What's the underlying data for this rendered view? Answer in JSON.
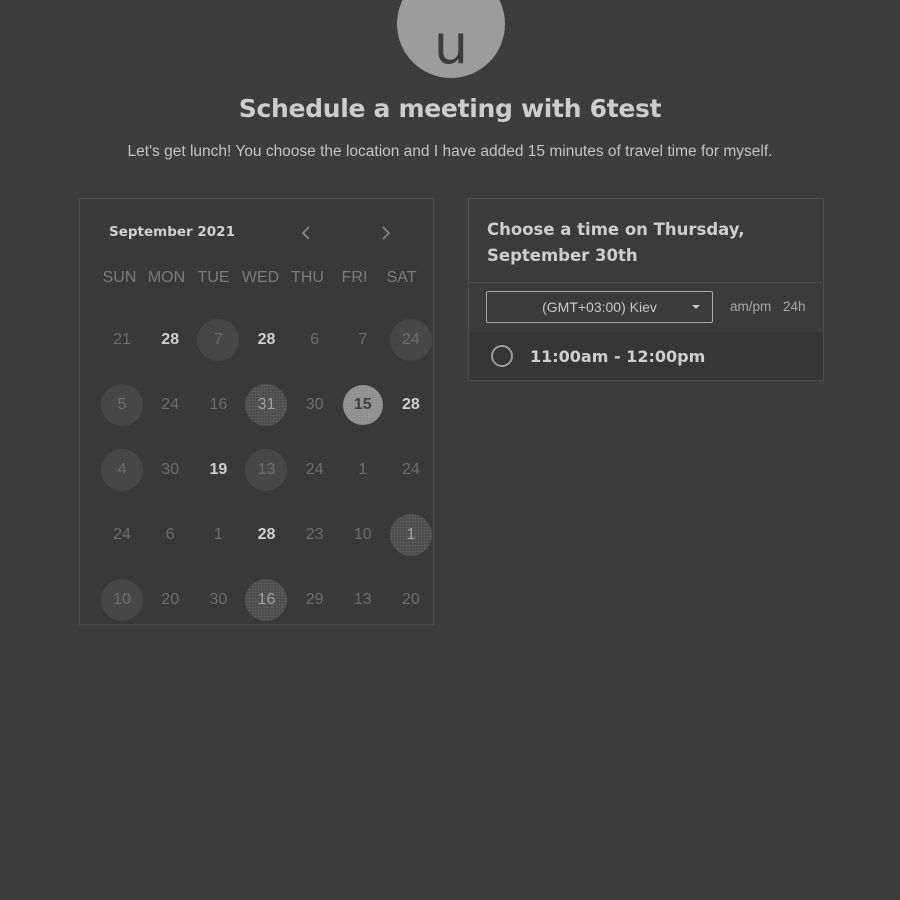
{
  "avatar": {
    "initial": "u"
  },
  "header": {
    "title": "Schedule a meeting with 6test",
    "subtitle": "Let's get lunch! You choose the location and I have added 15 minutes of travel time for myself."
  },
  "calendar": {
    "month": "September 2021",
    "weekdays": [
      "SUN",
      "MON",
      "TUE",
      "WED",
      "THU",
      "FRI",
      "SAT"
    ],
    "rows": [
      [
        {
          "d": "21",
          "s": "plain"
        },
        {
          "d": "28",
          "s": "bold"
        },
        {
          "d": "7",
          "s": "avail"
        },
        {
          "d": "28",
          "s": "bold"
        },
        {
          "d": "6",
          "s": "plain"
        },
        {
          "d": "7",
          "s": "plain"
        },
        {
          "d": "24",
          "s": "avail"
        }
      ],
      [
        {
          "d": "5",
          "s": "avail"
        },
        {
          "d": "24",
          "s": "plain"
        },
        {
          "d": "16",
          "s": "plain"
        },
        {
          "d": "31",
          "s": "dotted"
        },
        {
          "d": "30",
          "s": "plain"
        },
        {
          "d": "15",
          "s": "selected"
        },
        {
          "d": "28",
          "s": "bold"
        }
      ],
      [
        {
          "d": "4",
          "s": "avail"
        },
        {
          "d": "30",
          "s": "plain"
        },
        {
          "d": "19",
          "s": "bold"
        },
        {
          "d": "13",
          "s": "avail"
        },
        {
          "d": "24",
          "s": "plain"
        },
        {
          "d": "1",
          "s": "plain"
        },
        {
          "d": "24",
          "s": "plain"
        }
      ],
      [
        {
          "d": "24",
          "s": "plain"
        },
        {
          "d": "6",
          "s": "plain"
        },
        {
          "d": "1",
          "s": "plain"
        },
        {
          "d": "28",
          "s": "bold"
        },
        {
          "d": "23",
          "s": "plain"
        },
        {
          "d": "10",
          "s": "plain"
        },
        {
          "d": "1",
          "s": "dotted"
        }
      ],
      [
        {
          "d": "10",
          "s": "avail"
        },
        {
          "d": "20",
          "s": "plain"
        },
        {
          "d": "30",
          "s": "plain"
        },
        {
          "d": "16",
          "s": "dotted"
        },
        {
          "d": "29",
          "s": "plain"
        },
        {
          "d": "13",
          "s": "plain"
        },
        {
          "d": "20",
          "s": "plain"
        }
      ]
    ]
  },
  "time_panel": {
    "title": "Choose a time on Thursday, September 30th",
    "timezone": "(GMT+03:00) Kiev",
    "format_ampm": "am/pm",
    "format_24h": "24h",
    "slots": [
      "11:00am - 12:00pm"
    ]
  },
  "colors": {
    "background": "#3d3d3d",
    "selected": "#8e8e8e"
  }
}
